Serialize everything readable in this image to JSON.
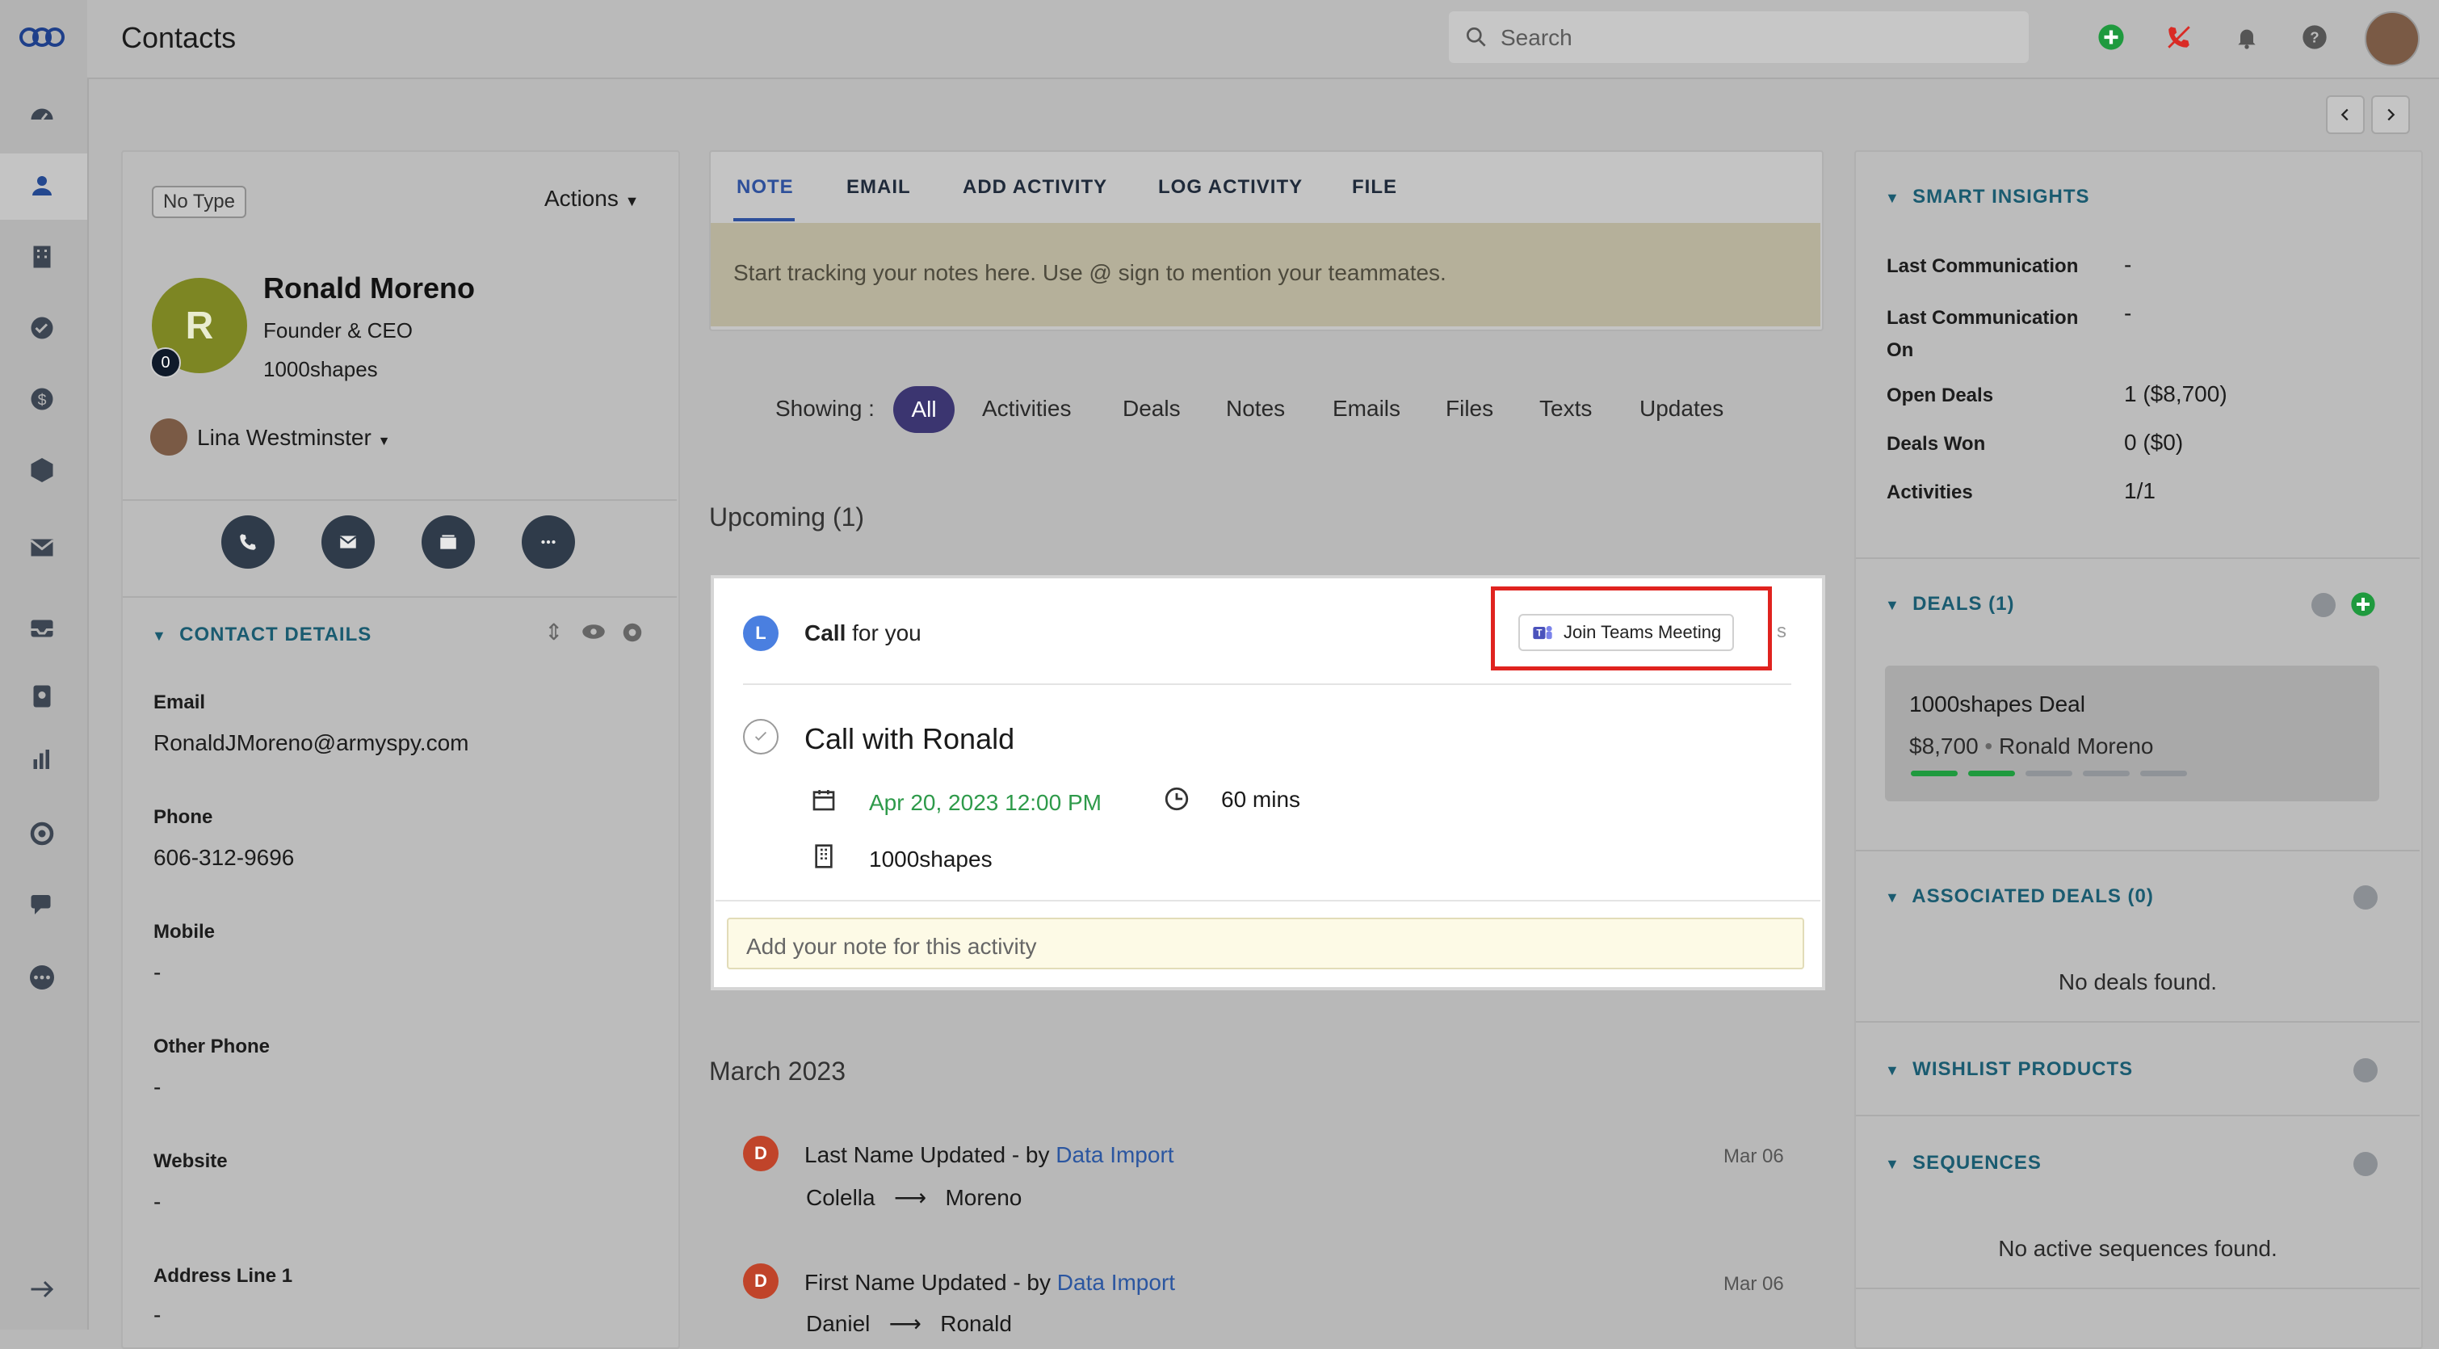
{
  "app": {
    "title": "Contacts"
  },
  "search": {
    "placeholder": "Search"
  },
  "contact": {
    "type_badge": "No Type",
    "actions_label": "Actions",
    "avatar_initial": "R",
    "badge_count": "0",
    "name": "Ronald Moreno",
    "job_title": "Founder & CEO",
    "company": "1000shapes",
    "owner": "Lina Westminster"
  },
  "contact_details": {
    "heading": "CONTACT DETAILS",
    "fields": [
      {
        "label": "Email",
        "value": "RonaldJMoreno@armyspy.com"
      },
      {
        "label": "Phone",
        "value": "606-312-9696"
      },
      {
        "label": "Mobile",
        "value": "-"
      },
      {
        "label": "Other Phone",
        "value": "-"
      },
      {
        "label": "Website",
        "value": "-"
      },
      {
        "label": "Address Line 1",
        "value": "-"
      }
    ]
  },
  "tabs": [
    "NOTE",
    "EMAIL",
    "ADD ACTIVITY",
    "LOG ACTIVITY",
    "FILE"
  ],
  "note": {
    "placeholder": "Start tracking your notes here. Use @ sign to mention your teammates."
  },
  "filters": {
    "label": "Showing :",
    "items": [
      "All",
      "Activities",
      "Deals",
      "Notes",
      "Emails",
      "Files",
      "Texts",
      "Updates"
    ]
  },
  "upcoming": {
    "heading": "Upcoming (1)",
    "assignee_initial": "L",
    "call_type": "Call",
    "call_for": "for you",
    "teams_button": "Join Teams Meeting",
    "trailing_text": "s",
    "title": "Call with Ronald",
    "date": "Apr 20, 2023 12:00 PM",
    "duration": "60 mins",
    "company": "1000shapes",
    "note_placeholder": "Add your note for this activity"
  },
  "timeline": {
    "month": "March 2023",
    "items": [
      {
        "initial": "D",
        "title": "Last Name Updated - by",
        "by": "Data Import",
        "date": "Mar 06",
        "from": "Colella",
        "to": "Moreno"
      },
      {
        "initial": "D",
        "title": "First Name Updated - by",
        "by": "Data Import",
        "date": "Mar 06",
        "from": "Daniel",
        "to": "Ronald"
      }
    ]
  },
  "insights": {
    "heading": "SMART INSIGHTS",
    "rows": [
      {
        "label": "Last Communication",
        "value": "-"
      },
      {
        "label": "Last Communication On",
        "value": "-"
      },
      {
        "label": "Open Deals",
        "value": "1 ($8,700)"
      },
      {
        "label": "Deals Won",
        "value": "0 ($0)"
      },
      {
        "label": "Activities",
        "value": "1/1"
      }
    ]
  },
  "deals": {
    "heading": "DEALS (1)",
    "card": {
      "name": "1000shapes Deal",
      "amount": "$8,700",
      "contact": "Ronald Moreno"
    },
    "stage_progress": {
      "completed": 2,
      "total": 5
    }
  },
  "associated_deals": {
    "heading": "ASSOCIATED DEALS (0)",
    "empty": "No deals found."
  },
  "wishlist": {
    "heading": "WISHLIST PRODUCTS"
  },
  "sequences": {
    "heading": "SEQUENCES",
    "empty": "No active sequences found."
  },
  "colors": {
    "accent_purple": "#3b3570",
    "teal": "#1a5b70",
    "highlight_red": "#e0231f",
    "green": "#1f9a3e",
    "link": "#2b56a0"
  }
}
